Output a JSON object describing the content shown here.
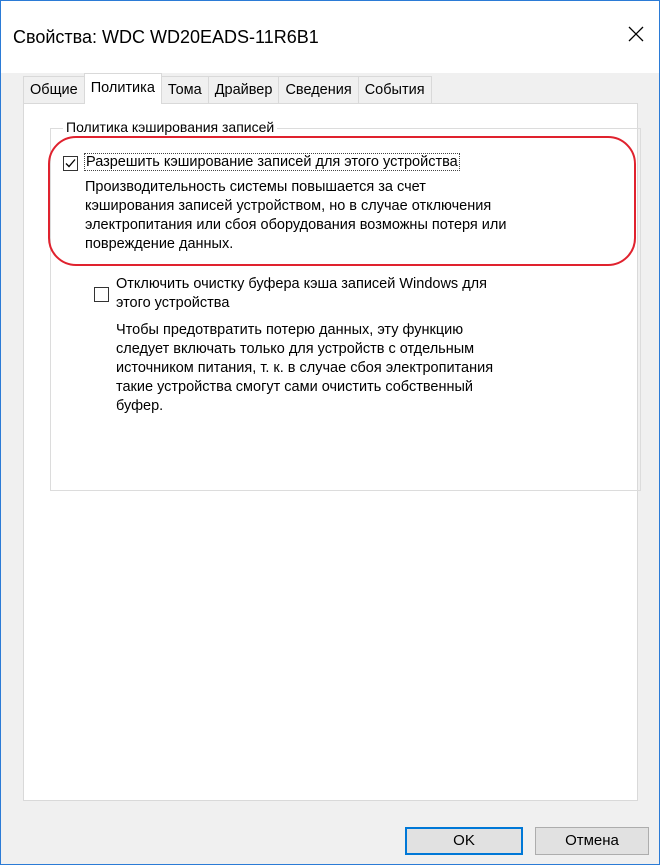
{
  "window": {
    "title": "Свойства: WDC WD20EADS-11R6B1"
  },
  "tabs": [
    {
      "label": "Общие",
      "active": false
    },
    {
      "label": "Политика",
      "active": true
    },
    {
      "label": "Тома",
      "active": false
    },
    {
      "label": "Драйвер",
      "active": false
    },
    {
      "label": "Сведения",
      "active": false
    },
    {
      "label": "События",
      "active": false
    }
  ],
  "policy": {
    "group_title": "Политика кэширования записей",
    "write_cache": {
      "label": "Разрешить кэширование записей для этого устройства",
      "checked": true,
      "description": "Производительность системы повышается за счет\nкэширования записей устройством, но в случае отключения\nэлектропитания или сбоя оборудования возможны потеря или\nповреждение данных."
    },
    "flush_off": {
      "label_line1": "Отключить очистку буфера кэша записей Windows для",
      "label_line2": "этого устройства",
      "checked": false,
      "description": "Чтобы предотвратить потерю данных, эту функцию\nследует включать только для устройств с отдельным\nисточником питания, т. к.  в случае сбоя электропитания\nтакие устройства смогут сами очистить собственный\nбуфер."
    }
  },
  "buttons": {
    "ok": "OK",
    "cancel": "Отмена"
  },
  "colors": {
    "highlight": "#e0222e",
    "accent": "#0078d7"
  }
}
